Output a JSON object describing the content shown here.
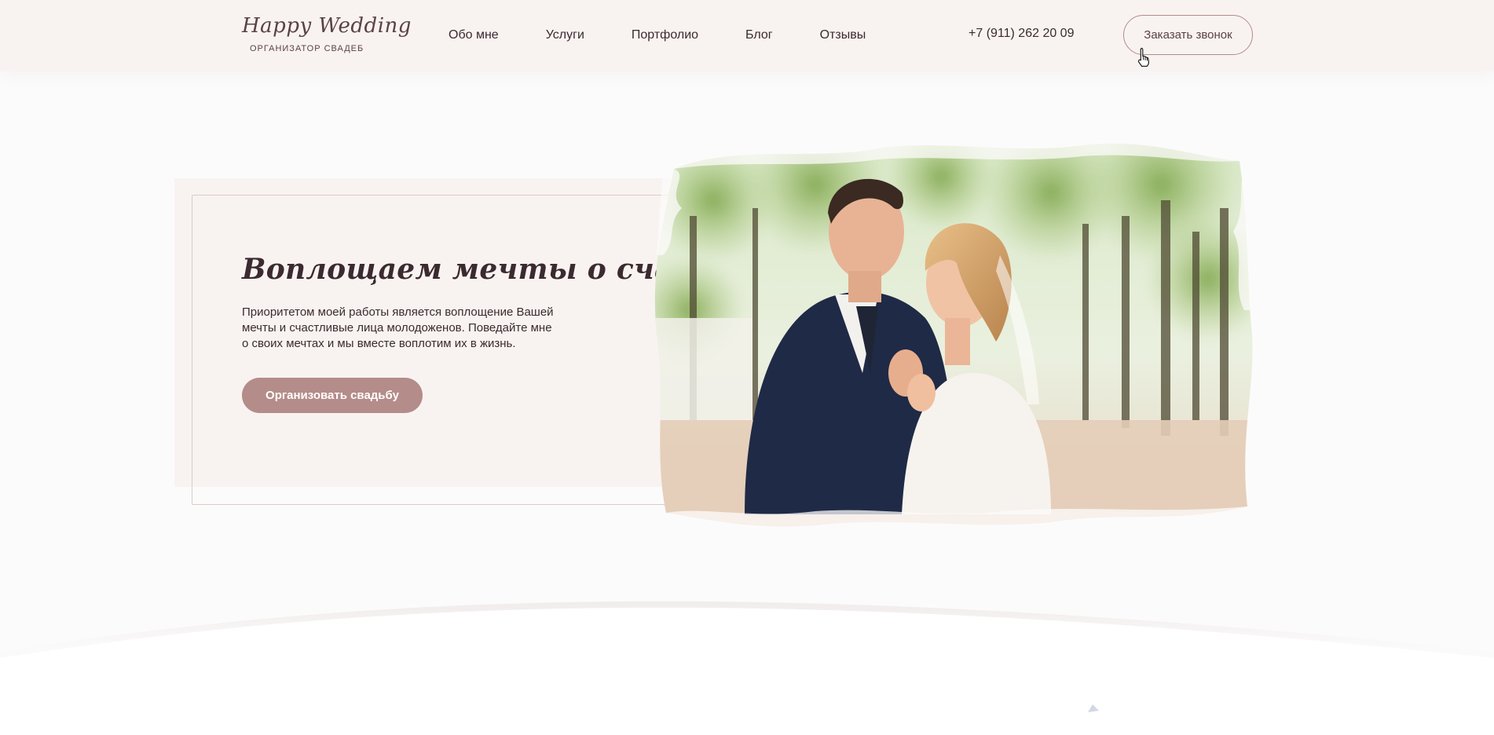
{
  "header": {
    "logo": {
      "script": "Happy Wedding",
      "subtitle": "ОРГАНИЗАТОР СВАДЕБ"
    },
    "nav": [
      {
        "label": "Обо мне"
      },
      {
        "label": "Услуги"
      },
      {
        "label": "Портфолио"
      },
      {
        "label": "Блог"
      },
      {
        "label": "Отзывы"
      }
    ],
    "phone": "+7 (911) 262 20 09",
    "call_button": "Заказать звонок"
  },
  "hero": {
    "title": "Воплощаем мечты о счастье",
    "text_lines": [
      "Приоритетом моей работы является воплощение Вашей",
      "мечты и счастливые лица молодоженов. Поведайте мне",
      "о своих мечтах и мы вместе воплотим их в жизнь."
    ],
    "button": "Организовать свадьбу",
    "photo_icon": "wedding-couple-photo"
  },
  "colors": {
    "accent": "#b48c89",
    "header_bg": "#f8f3f1",
    "text": "#3b2a2f",
    "page_bg": "#fcfbfb"
  },
  "icons": {
    "cursor": "hand-pointer-icon"
  }
}
